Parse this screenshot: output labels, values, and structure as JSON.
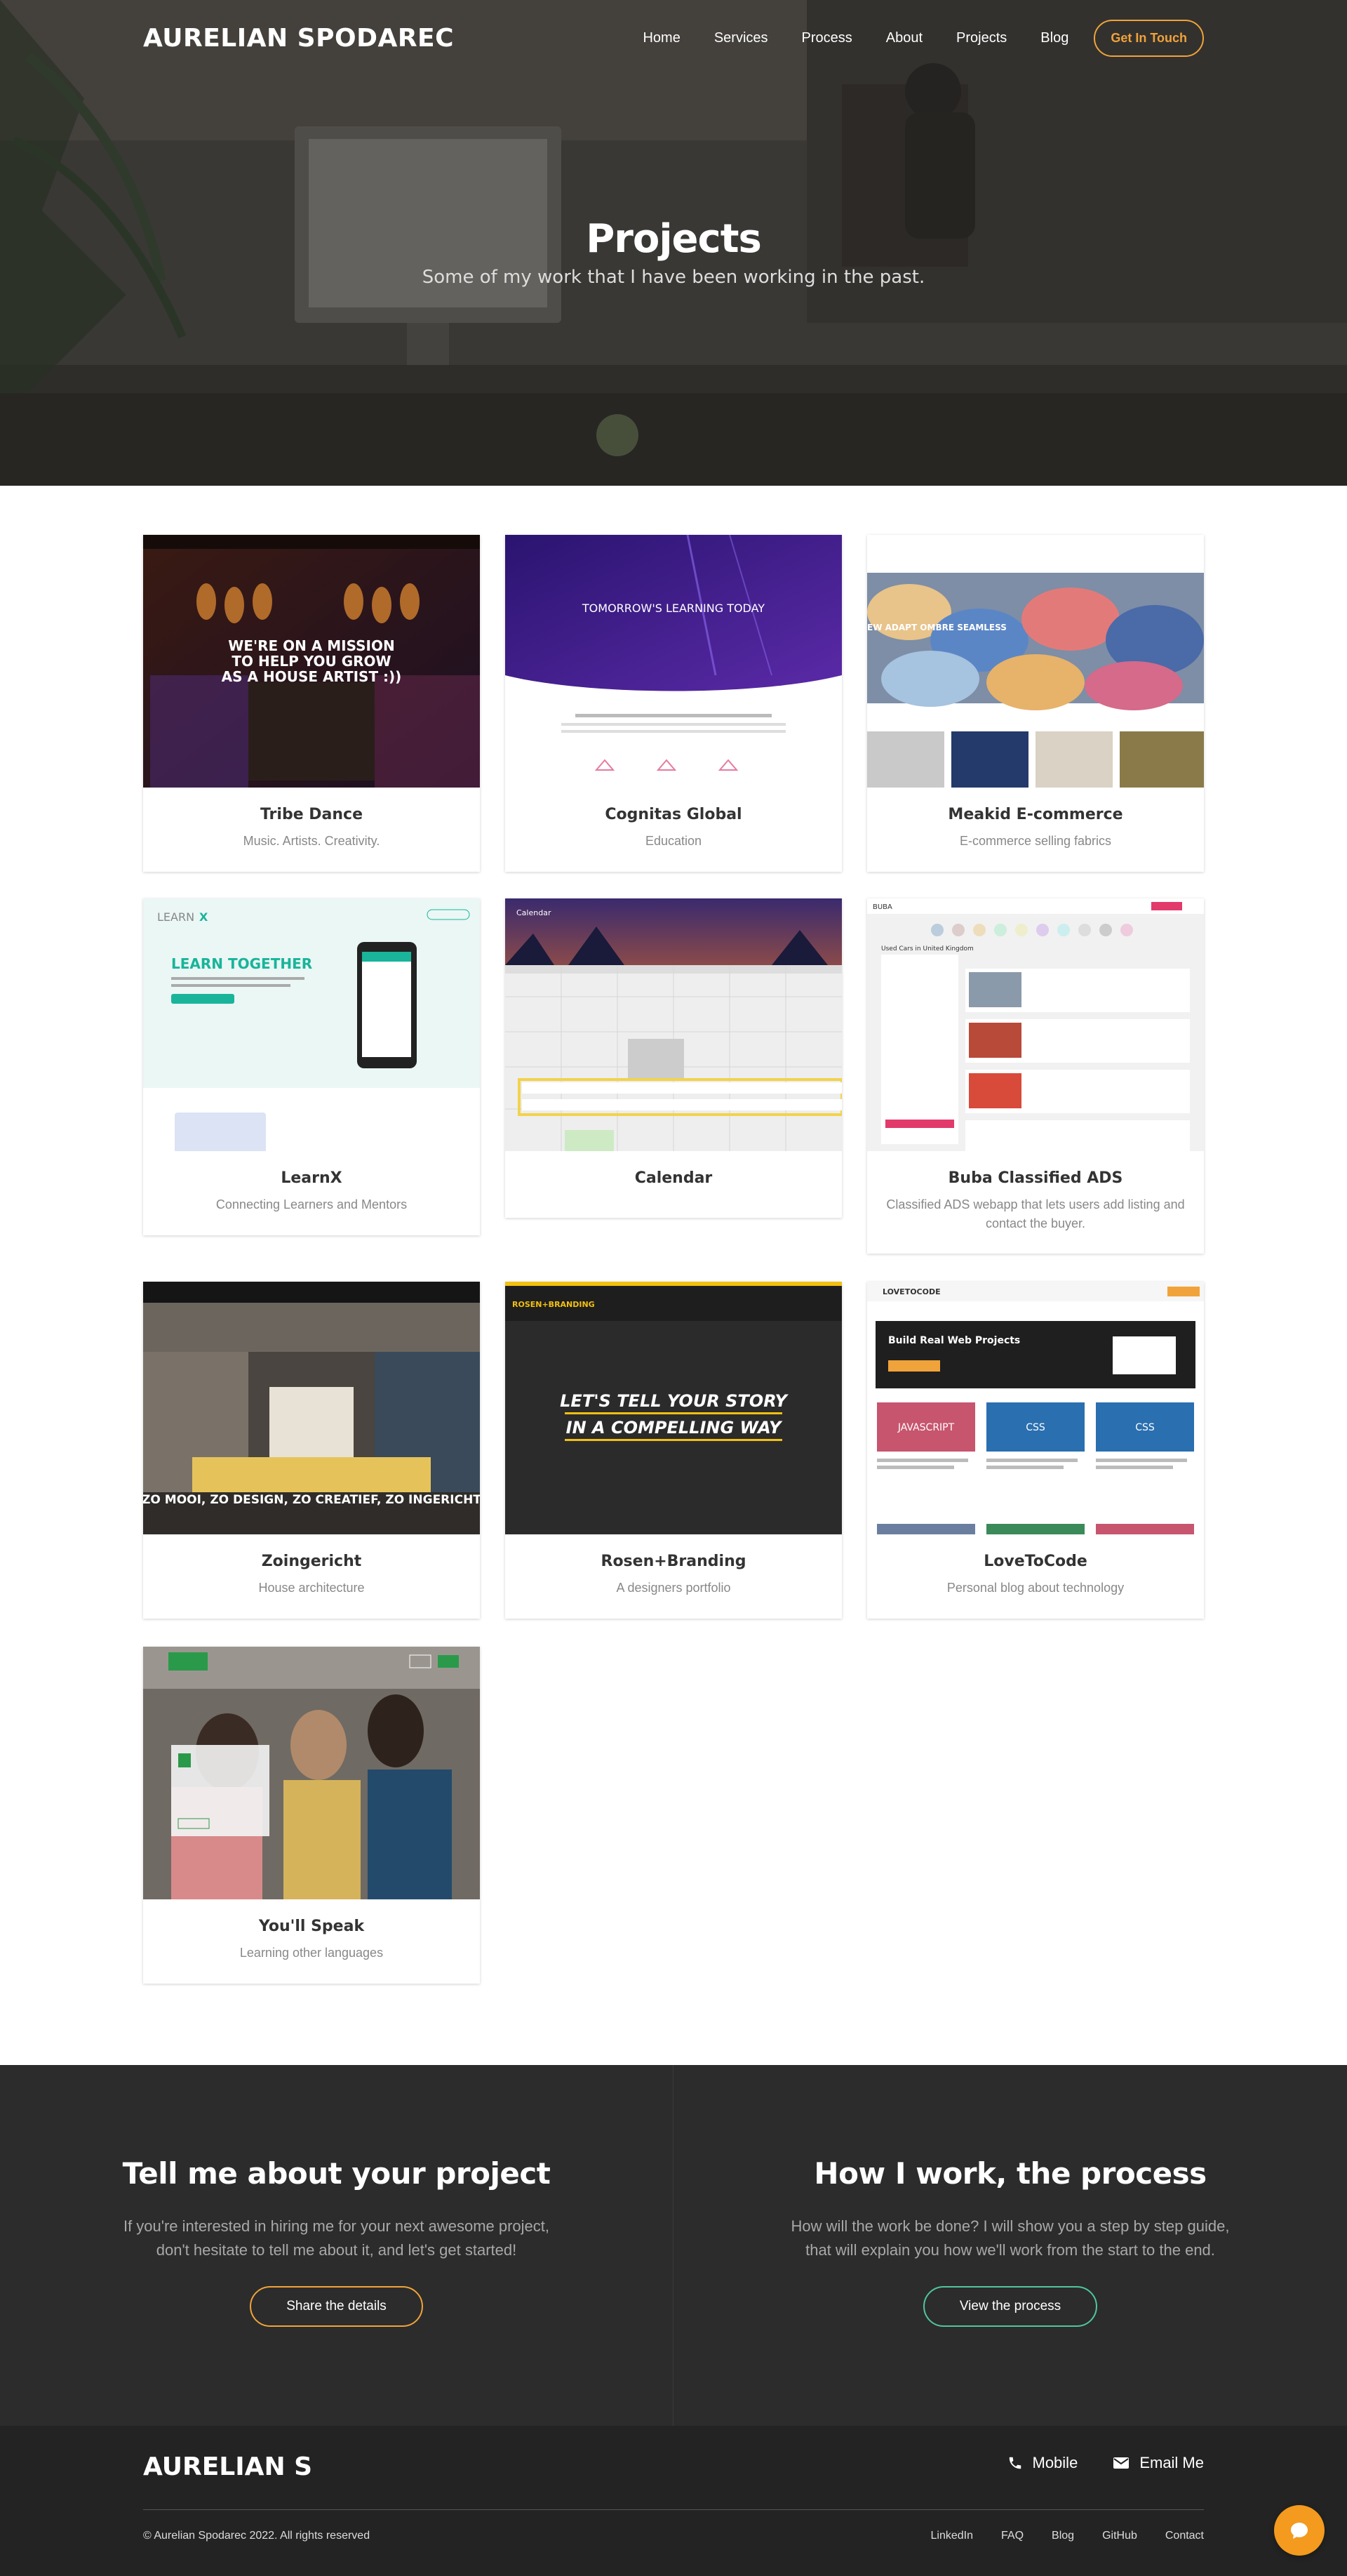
{
  "header": {
    "brand": "AURELIAN SPODAREC",
    "nav": [
      "Home",
      "Services",
      "Process",
      "About",
      "Projects",
      "Blog"
    ],
    "cta": "Get In Touch"
  },
  "hero": {
    "title": "Projects",
    "subtitle": "Some of my work that I have been working in the past."
  },
  "projects": [
    {
      "title": "Tribe Dance",
      "desc": "Music. Artists. Creativity.",
      "thumb_text": "WE'RE ON A MISSION TO HELP YOU GROW AS A HOUSE ARTIST :))"
    },
    {
      "title": "Cognitas Global",
      "desc": "Education",
      "thumb_text": "TOMORROW'S LEARNING TODAY"
    },
    {
      "title": "Meakid E-commerce",
      "desc": "E-commerce selling fabrics",
      "thumb_text": "EW ADAPT OMBRE SEAMLESS"
    },
    {
      "title": "LearnX",
      "desc": "Connecting Learners and Mentors",
      "thumb_text": "LEARN TOGETHER"
    },
    {
      "title": "Calendar",
      "desc": "",
      "thumb_text": "Calendar"
    },
    {
      "title": "Buba Classified ADS",
      "desc": "Classified ADS webapp that lets users add listing and contact the buyer.",
      "thumb_text": "Used Cars in United Kingdom"
    },
    {
      "title": "Zoingericht",
      "desc": "House architecture",
      "thumb_text": "ZO MOOI, ZO DESIGN, ZO CREATIEF, ZO INGERICHT"
    },
    {
      "title": "Rosen+Branding",
      "desc": "A designers portfolio",
      "thumb_text": "LET'S TELL YOUR STORY IN A COMPELLING WAY"
    },
    {
      "title": "LoveToCode",
      "desc": "Personal blog about technology",
      "thumb_text": "Build Real Web Projects"
    },
    {
      "title": "You'll Speak",
      "desc": "Learning other languages",
      "thumb_text": ""
    }
  ],
  "cta_left": {
    "title": "Tell me about your project",
    "text": "If you're interested in hiring me for your next awesome project, don't hesitate to tell me about it, and let's get started!",
    "button": "Share the details"
  },
  "cta_right": {
    "title": "How I work, the process",
    "text": "How will the work be done? I will show you a step by step guide, that will explain you how we'll work from the start to the end.",
    "button": "View the process"
  },
  "footer": {
    "brand": "AURELIAN S",
    "mobile": "Mobile",
    "email": "Email Me",
    "copyright": "© Aurelian Spodarec 2022. All rights reserved",
    "links": [
      "LinkedIn",
      "FAQ",
      "Blog",
      "GitHub",
      "Contact"
    ]
  },
  "colors": {
    "accent": "#f0a33a",
    "green": "#4fc6a0",
    "dark": "#2c2c2c"
  }
}
